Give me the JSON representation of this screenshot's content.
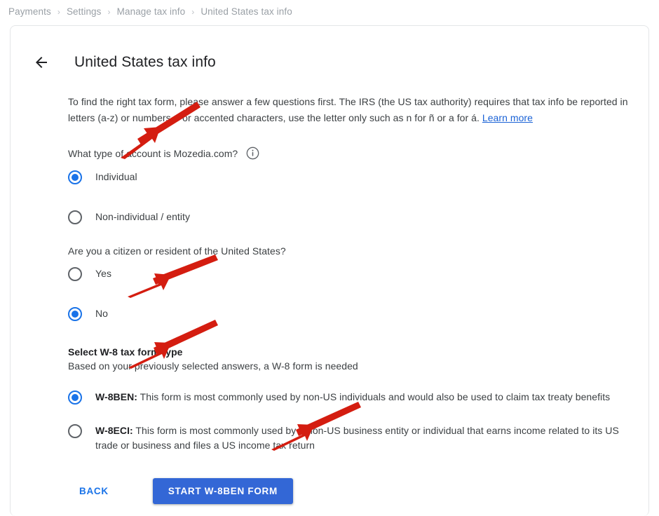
{
  "breadcrumb": {
    "separator": "›",
    "items": [
      {
        "label": "Payments"
      },
      {
        "label": "Settings"
      },
      {
        "label": "Manage tax info"
      },
      {
        "label": "United States tax info"
      }
    ]
  },
  "header": {
    "back_icon": "arrow-left-icon",
    "title": "United States tax info"
  },
  "intro": {
    "text": "To find the right tax form, please answer a few questions first. The IRS (the US tax authority) requires that tax info be reported in letters (a-z) or numbers. For accented characters, use the letter only such as n for ñ or a for á. ",
    "link_label": "Learn more"
  },
  "question_account": {
    "label": "What type of account is Mozedia.com?",
    "info_icon": "info-circle-icon",
    "options": [
      {
        "label": "Individual",
        "selected": true
      },
      {
        "label": "Non-individual / entity",
        "selected": false
      }
    ]
  },
  "question_citizen": {
    "label": "Are you a citizen or resident of the United States?",
    "options": [
      {
        "label": "Yes",
        "selected": false
      },
      {
        "label": "No",
        "selected": true
      }
    ]
  },
  "form_type": {
    "heading": "Select W-8 tax form type",
    "subheading": "Based on your previously selected answers, a W-8 form is needed",
    "options": [
      {
        "name": "W-8BEN:",
        "description": " This form is most commonly used by non-US individuals and would also be used to claim tax treaty benefits",
        "selected": true
      },
      {
        "name": "W-8ECI:",
        "description": " This form is most commonly used by a non-US business entity or individual that earns income related to its US trade or business and files a US income tax return",
        "selected": false
      }
    ]
  },
  "actions": {
    "back_label": "BACK",
    "submit_label": "START W-8BEN FORM"
  },
  "colors": {
    "accent_blue": "#1a73e8",
    "button_blue": "#3367d6",
    "link_blue": "#1a62d6",
    "annotation_red": "#d41d10",
    "text_primary": "#202124",
    "text_secondary": "#3c4043",
    "breadcrumb_gray": "#9aa0a6"
  },
  "annotations": [
    {
      "name": "arrow-to-individual-radio"
    },
    {
      "name": "arrow-to-no-radio"
    },
    {
      "name": "arrow-to-w8ben-radio"
    },
    {
      "name": "arrow-to-start-form-button"
    }
  ]
}
